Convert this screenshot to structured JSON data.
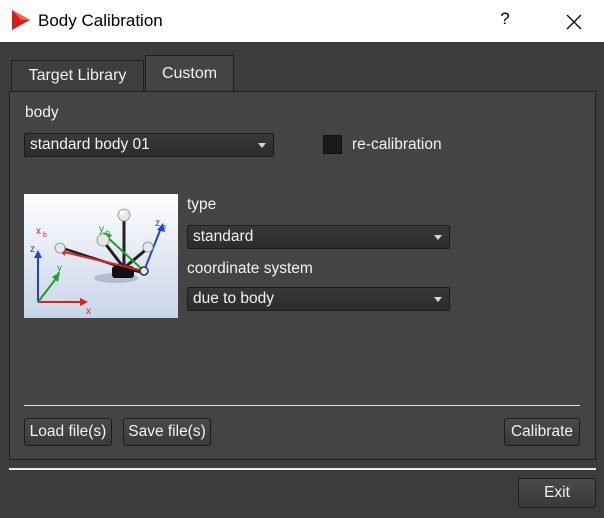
{
  "window": {
    "title": "Body Calibration",
    "help_label": "?",
    "close_icon": "close-icon",
    "app_icon": "play-triangle-icon",
    "app_icon_color": "#d51f1f"
  },
  "tabs": [
    {
      "label": "Target Library",
      "selected": false
    },
    {
      "label": "Custom",
      "selected": true
    }
  ],
  "body_section": {
    "label": "body",
    "selected_value": "standard body 01",
    "recalibration_label": "re-calibration",
    "recalibration_checked": false
  },
  "type_section": {
    "label": "type",
    "selected_value": "standard"
  },
  "coord_section": {
    "label": "coordinate system",
    "selected_value": "due to body"
  },
  "diagram": {
    "axis_labels": {
      "x": "x",
      "y": "y",
      "z": "z",
      "xb": "x",
      "xb_sub": "b",
      "yb": "y",
      "yb_sub": "b",
      "zb": "z",
      "zb_sub": "b"
    },
    "colors": {
      "x": "#e02020",
      "y": "#20a020",
      "z": "#2040e0"
    }
  },
  "buttons": {
    "load": "Load file(s)",
    "save": "Save file(s)",
    "calibrate": "Calibrate",
    "exit": "Exit"
  }
}
